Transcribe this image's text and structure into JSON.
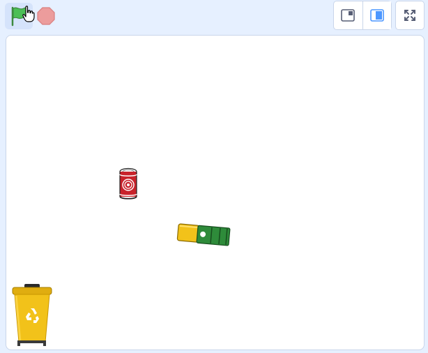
{
  "toolbar": {
    "green_flag": {
      "icon": "green-flag-icon",
      "color": "#4cbf56"
    },
    "stop": {
      "icon": "stop-icon",
      "color": "#ec9c9c"
    },
    "layout_modes": [
      {
        "name": "small-stage-mode",
        "icon": "small-stage-icon",
        "active": false
      },
      {
        "name": "normal-stage-mode",
        "icon": "normal-stage-icon",
        "active": true
      }
    ],
    "fullscreen": {
      "icon": "fullscreen-icon"
    }
  },
  "stage": {
    "sprites": [
      {
        "name": "soda-can",
        "icon": "soda-can-icon",
        "color": "#c8232b"
      },
      {
        "name": "battery",
        "icon": "battery-icon",
        "color": "#2e8b3a"
      },
      {
        "name": "recycle-bin",
        "icon": "recycle-bin-icon",
        "color": "#f2c21a"
      }
    ]
  },
  "cursor": {
    "icon": "hand-pointer-icon"
  }
}
